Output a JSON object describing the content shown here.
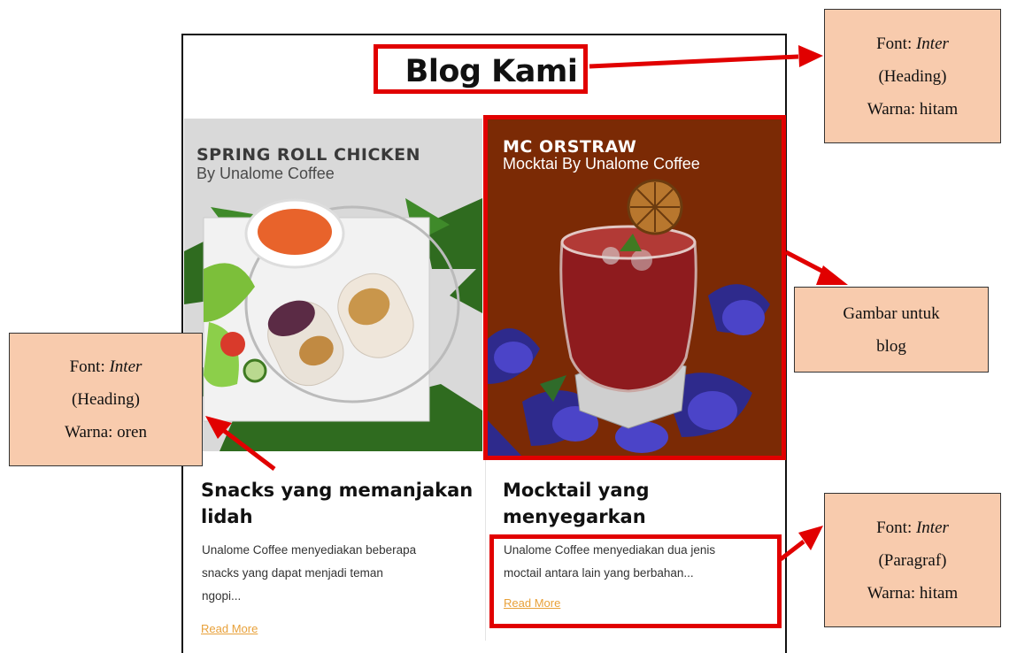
{
  "blog": {
    "title": "Blog Kami",
    "cards": [
      {
        "image_heading": "SPRING ROLL CHICKEN",
        "image_subheading": "By Unalome Coffee",
        "title_line1": "Snacks yang memanjakan",
        "title_line2": "lidah",
        "text_line1": "Unalome Coffee menyediakan beberapa",
        "text_line2": "snacks yang dapat menjadi teman",
        "text_line3": "ngopi...",
        "read_more": "Read More"
      },
      {
        "image_heading": "MC  ORSTRAW",
        "image_subheading": "Mocktai By Unalome Coffee",
        "title_line1": "Mocktail yang",
        "title_line2": "menyegarkan",
        "text_line1": "Unalome Coffee menyediakan dua jenis",
        "text_line2": "moctail antara lain yang berbahan...",
        "read_more": "Read More"
      }
    ]
  },
  "annotations": {
    "heading_note": {
      "font_label": "Font:",
      "font_name": "Inter",
      "role": "(Heading)",
      "color": "Warna: hitam"
    },
    "image_note": {
      "line1": "Gambar untuk",
      "line2": "blog"
    },
    "left_note": {
      "font_label": "Font:",
      "font_name": "Inter",
      "role": "(Heading)",
      "color": "Warna: oren"
    },
    "paragraph_note": {
      "font_label": "Font:",
      "font_name": "Inter",
      "role": "(Paragraf)",
      "color": "Warna: hitam"
    }
  },
  "colors": {
    "highlight": "#e10000",
    "callout_fill": "#f8cbad",
    "read_more": "#e8a13a",
    "mocktail_bg": "#7b2a05"
  }
}
